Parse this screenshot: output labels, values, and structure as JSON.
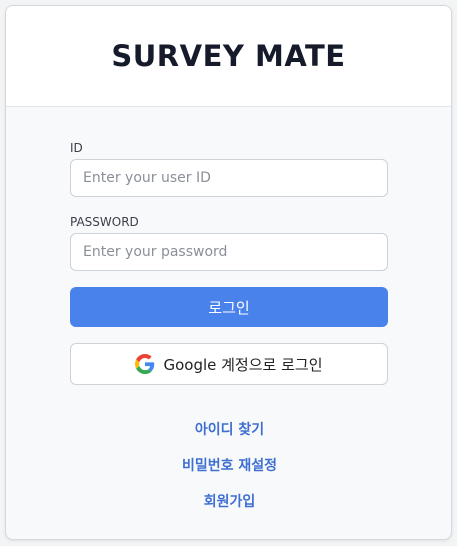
{
  "header": {
    "title": "SURVEY MATE"
  },
  "form": {
    "id_label": "ID",
    "id_placeholder": "Enter your user ID",
    "id_value": "",
    "password_label": "PASSWORD",
    "password_placeholder": "Enter your password",
    "password_value": "",
    "login_label": "로그인",
    "google_login_label": "Google 계정으로 로그인"
  },
  "links": {
    "find_id": "아이디 찾기",
    "reset_password": "비밀번호 재설정",
    "signup": "회원가입"
  },
  "icons": {
    "google": "google-icon"
  },
  "colors": {
    "primary": "#4a82ec",
    "link": "#3f6fd1",
    "title": "#161b2b"
  }
}
